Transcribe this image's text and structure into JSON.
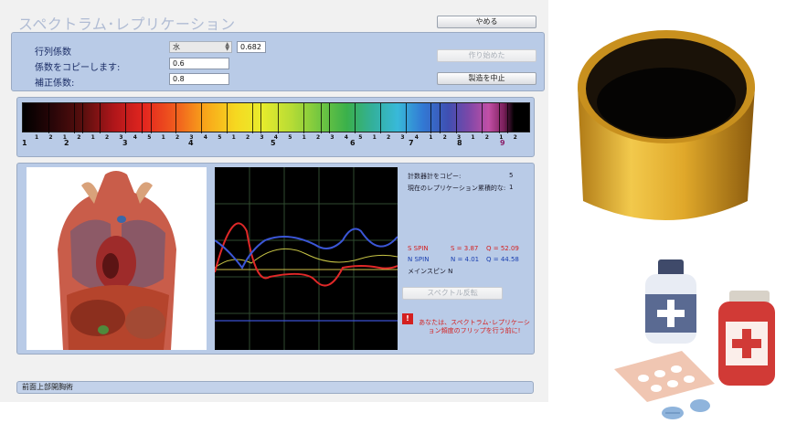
{
  "app": {
    "title": "スペクトラム･レプリケーション",
    "stop_button": "やめる",
    "start_button": "作り始めた",
    "cancel_button": "製造を中止"
  },
  "params": {
    "matrix_label": "行列係数",
    "matrix_select": "水",
    "matrix_value": "0.682",
    "copy_label": "係数をコピーします:",
    "copy_value": "0.6",
    "correction_label": "補正係数:",
    "correction_value": "0.8"
  },
  "spectrum": {
    "major_ticks": [
      "1",
      "2",
      "3",
      "4",
      "5",
      "6",
      "7",
      "8",
      "9"
    ],
    "minor_ticks": [
      "1",
      "2",
      "1",
      "2",
      "1",
      "2",
      "3",
      "4",
      "5",
      "1",
      "2",
      "3",
      "4",
      "5",
      "1",
      "2",
      "3",
      "4",
      "5",
      "1",
      "2",
      "3",
      "4",
      "5",
      "1",
      "2",
      "3",
      "4",
      "1",
      "2",
      "3",
      "1",
      "2",
      "1",
      "2"
    ]
  },
  "info": {
    "counter_copy_label": "計数器計をコピー:",
    "counter_copy_value": "5",
    "current_replication_label": "現在のレプリケーション累積的な:",
    "current_replication_value": "1",
    "s_spin_label": "S SPIN",
    "s_value": "S = 3.87",
    "s_q": "Q = 52.09",
    "n_spin_label": "N SPIN",
    "n_value": "N = 4.01",
    "n_q": "Q = 44.58",
    "main_spin": "メインスピン N",
    "spectrum_invert_button": "スペクトル反転",
    "warning": "あなたは、スペクトラム･レプリケーション頻度のフリップを行う前に!"
  },
  "status": {
    "text": "前面上部開胸術"
  },
  "colors": {
    "panel": "#b9cbe7",
    "s_spin": "#d42020",
    "n_spin": "#1a3fb0",
    "title": "#b0bcd4"
  }
}
